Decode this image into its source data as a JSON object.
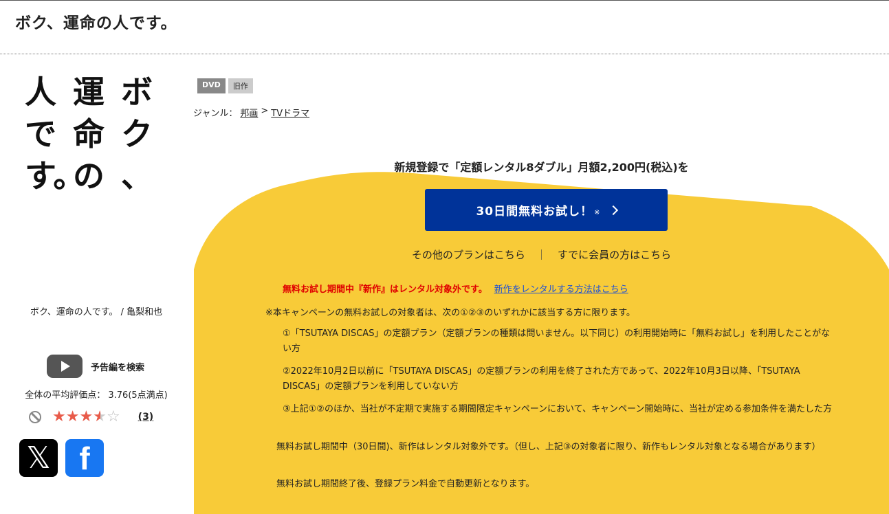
{
  "page": {
    "title": "ボク、運命の人です。"
  },
  "jacket": {
    "columns": [
      [
        "ボ",
        "ク",
        "、"
      ],
      [
        "運",
        "命",
        "の"
      ],
      [
        "人",
        "で",
        "す。"
      ]
    ],
    "caption": "ボク、運命の人です。 / 亀梨和也"
  },
  "trailer": {
    "label": "予告編を検索"
  },
  "rating": {
    "average_text": "全体の平均評価点： 3.76(5点満点)",
    "stars_value": 3.76,
    "review_count": "(3)"
  },
  "social": {
    "x_label": "𝕏",
    "facebook_label": "f"
  },
  "badges": [
    "DVD",
    "旧作"
  ],
  "genre": {
    "prefix": "ジャンル：",
    "main": "邦画",
    "sep": ">",
    "sub": "TVドラマ"
  },
  "promo": {
    "headline": "新規登録で「定額レンタル8ダブル」月額2,200円(税込)を",
    "cta_label": "30日間無料お試し！",
    "cta_note": "※",
    "other_plans": "その他のプランはこちら",
    "separator": "｜",
    "member_login": "すでに会員の方はこちら"
  },
  "warning": {
    "red_text": "無料お試し期間中『新作』はレンタル対象外です。",
    "link_text": "新作をレンタルする方法はこちら"
  },
  "notice": "※本キャンペーンの無料お試しの対象者は、次の①②③のいずれかに該当する方に限ります。",
  "conditions": [
    "①「TSUTAYA DISCAS」の定額プラン（定額プランの種類は問いません。以下同じ）の利用開始時に「無料お試し」を利用したことがない方",
    "②2022年10月2日以前に「TSUTAYA DISCAS」の定額プランの利用を終了された方であって、2022年10月3日以降、「TSUTAYA DISCAS」の定額プランを利用していない方",
    "③上記①②のほか、当社が不定期で実施する期間限定キャンペーンにおいて、キャンペーン開始時に、当社が定める参加条件を満たした方"
  ],
  "paragraphs": [
    "無料お試し期間中（30日間)、新作はレンタル対象外です。（但し、上記③の対象者に限り、新作もレンタル対象となる場合があります）",
    "無料お試し期間終了後、登録プラン料金で自動更新となります。"
  ],
  "colors": {
    "yellow": "#f8cb38",
    "cta_blue": "#003399",
    "warning_red": "#e00000",
    "link_blue": "#1a4fd8"
  }
}
